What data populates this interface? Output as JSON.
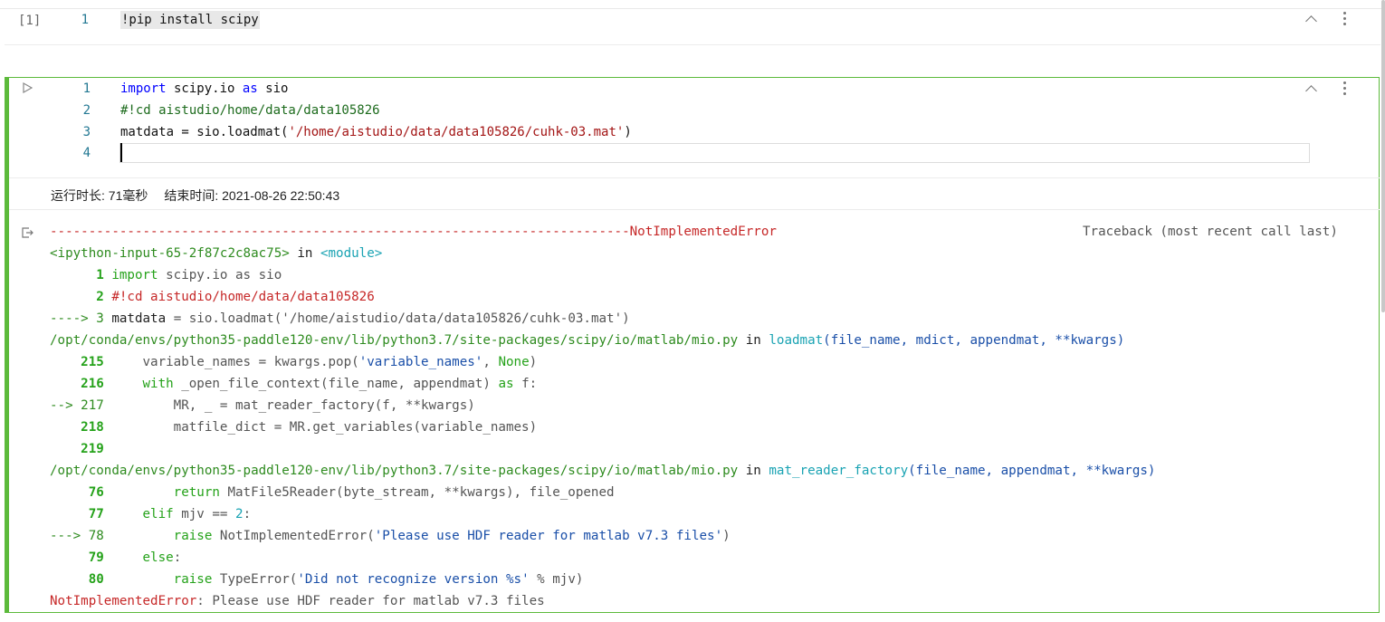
{
  "cell1": {
    "prompt": "[1]",
    "line_number": "1",
    "code": "!pip install scipy"
  },
  "cell2": {
    "line_numbers": [
      "1",
      "2",
      "3",
      "4"
    ],
    "code": {
      "l1_kw1": "import",
      "l1_mod": " scipy.io ",
      "l1_kw2": "as",
      "l1_alias": " sio",
      "l2": "#!cd aistudio/home/data/data105826",
      "l3_a": "matdata = sio.loadmat(",
      "l3_str": "'/home/aistudio/data/data105826/cuhk-03.mat'",
      "l3_b": ")"
    },
    "run_info": {
      "duration": "运行时长: 71毫秒",
      "end_time": "结束时间: 2021-08-26 22:50:43"
    }
  },
  "output": {
    "sep_line": "---------------------------------------------------------------------------NotImplementedError",
    "traceback_label": "Traceback (most recent call last)",
    "l2_a": "<ipython-input-65-2f87c2c8ac75>",
    "l2_b": " in ",
    "l2_c": "<module>",
    "l3_num": "      1 ",
    "l3_kw": "import",
    "l3_rest": " scipy.io as sio",
    "l4_num": "      2 ",
    "l4_rest": "#!cd aistudio/home/data/data105826",
    "l5_arrow": "----> 3 ",
    "l5_a": "matdata ",
    "l5_b": "= sio.loadmat(",
    "l5_str": "'/home/aistudio/data/data105826/cuhk-03.mat'",
    "l5_c": ")",
    "l6_path": "/opt/conda/envs/python35-paddle120-env/lib/python3.7/site-packages/scipy/io/matlab/mio.py",
    "l6_in": " in ",
    "l6_fn": "loadmat",
    "l6_args": "(file_name, mdict, appendmat, **kwargs)",
    "l7_num": "    215 ",
    "l7_a": "    variable_names = kwargs.pop(",
    "l7_str": "'variable_names'",
    "l7_b": ", ",
    "l7_none": "None",
    "l7_c": ")",
    "l8_num": "    216 ",
    "l8_kw": "    with",
    "l8_a": " _open_file_context(file_name, appendmat) ",
    "l8_kw2": "as",
    "l8_b": " f:",
    "l9_arrow": "--> 217 ",
    "l9_a": "        MR, _ = mat_reader_factory(f, **kwargs)",
    "l10_num": "    218 ",
    "l10_a": "        matfile_dict = MR.get_variables(variable_names)",
    "l11_num": "    219 ",
    "l12_path": "/opt/conda/envs/python35-paddle120-env/lib/python3.7/site-packages/scipy/io/matlab/mio.py",
    "l12_in": " in ",
    "l12_fn": "mat_reader_factory",
    "l12_args": "(file_name, appendmat, **kwargs)",
    "l13_num": "     76 ",
    "l13_kw": "        return",
    "l13_a": " MatFile5Reader(byte_stream, **kwargs), file_opened",
    "l14_num": "     77 ",
    "l14_kw": "    elif",
    "l14_a": " mjv == ",
    "l14_n": "2",
    "l14_b": ":",
    "l15_arrow": "---> 78 ",
    "l15_kw": "        raise",
    "l15_a": " NotImplementedError(",
    "l15_str": "'Please use HDF reader for matlab v7.3 files'",
    "l15_b": ")",
    "l16_num": "     79 ",
    "l16_kw": "    else",
    "l16_a": ":",
    "l17_num": "     80 ",
    "l17_kw": "        raise",
    "l17_a": " TypeError(",
    "l17_str": "'Did not recognize version %s'",
    "l17_b": " % mjv)",
    "err_name": "NotImplementedError",
    "err_msg": ": Please use HDF reader for matlab v7.3 files"
  }
}
